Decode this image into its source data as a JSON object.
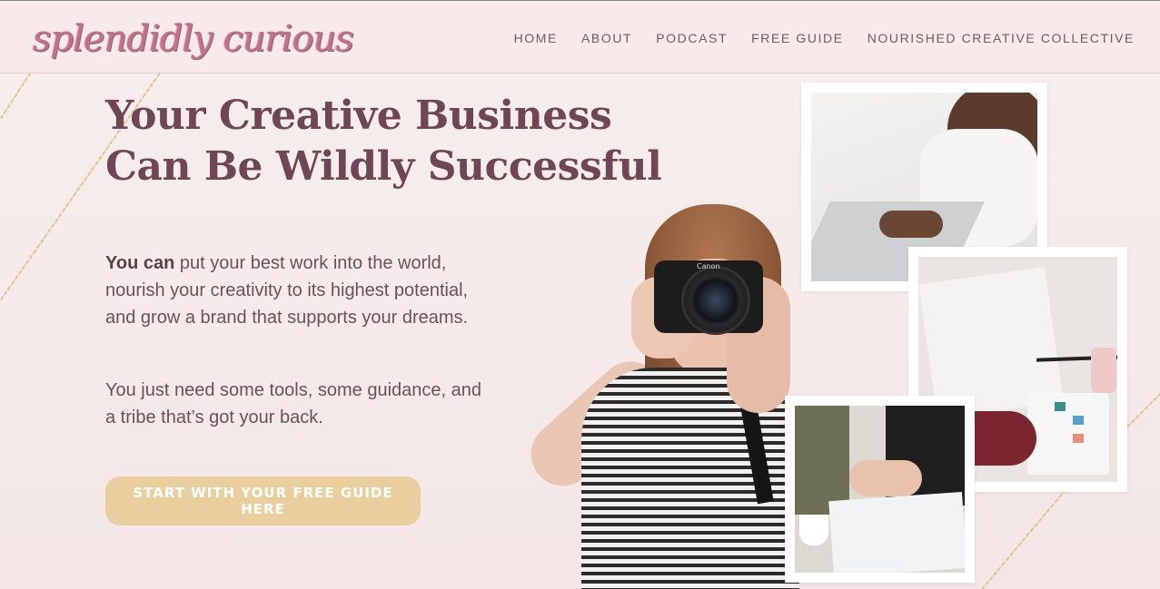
{
  "header": {
    "logo_text": "splendidly curious",
    "nav": [
      "HOME",
      "ABOUT",
      "PODCAST",
      "FREE GUIDE",
      "NOURISHED CREATIVE COLLECTIVE"
    ]
  },
  "hero": {
    "headline_line1": "Your Creative Business",
    "headline_line2": "Can Be Wildly Successful",
    "para1_bold": "You can",
    "para1_rest": " put your best work into the world, nourish your creativity to its highest potential, and grow a brand that supports your dreams.",
    "para2": "You just need some tools, some guidance, and a tribe that’s got your back.",
    "cta_label": "START WITH YOUR FREE GUIDE HERE",
    "camera_brand": "Canon"
  },
  "colors": {
    "headline": "#6f4656",
    "body_text": "#6a5259",
    "cta_bg": "#e8cf9d",
    "nav_text": "#6f5a60",
    "background": "#f6e9e8"
  },
  "icons": [
    "logo-icon"
  ]
}
